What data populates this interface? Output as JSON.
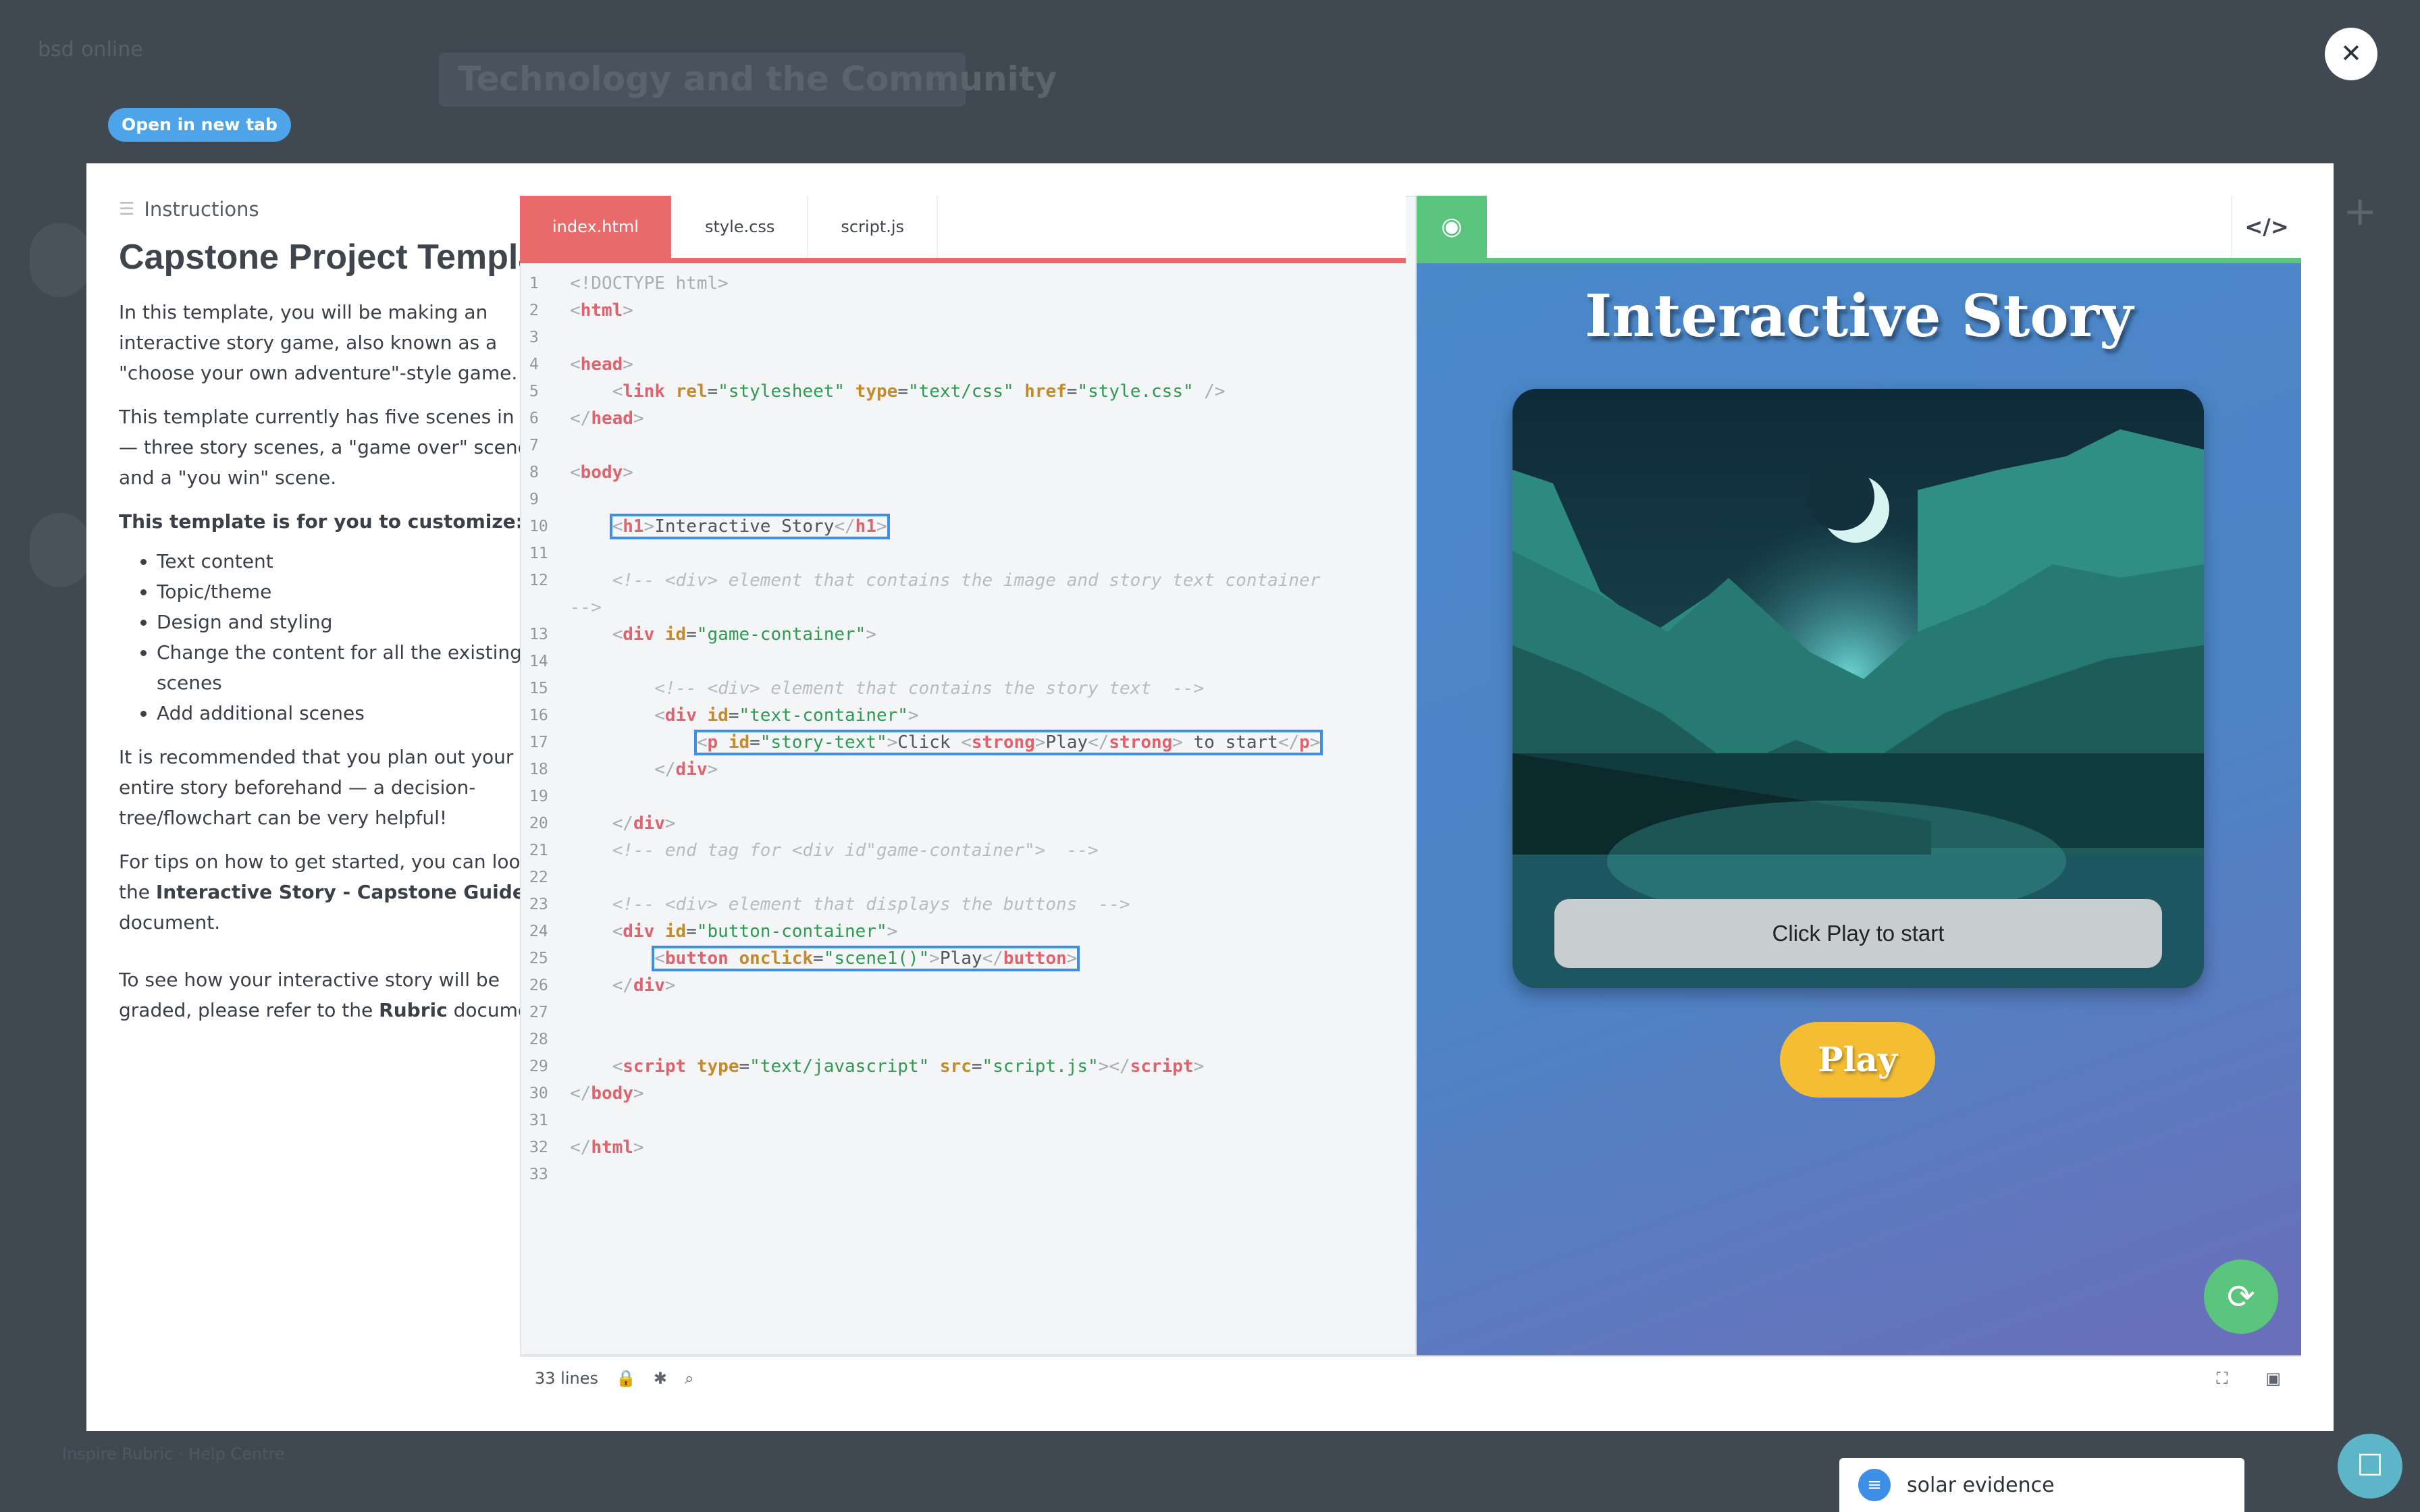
{
  "background": {
    "logo": "bsd",
    "logo_suffix": "online",
    "page_title": "Technology and the Community",
    "footer": "Inspire Rubric · Help Centre"
  },
  "modal": {
    "open_new_tab": "Open in new tab",
    "close_icon": "close-icon"
  },
  "instructions": {
    "header": "Instructions",
    "title": "Capstone Project Template",
    "p1": "In this template, you will be making an interactive story game, also known as a \"choose your own adventure\"-style game.",
    "p2": "This template currently has five scenes in total — three story scenes, a \"game over\" scene, and a \"you win\" scene.",
    "p3_bold": "This template is for you to customize:",
    "bullets": [
      "Text content",
      "Topic/theme",
      "Design and styling",
      "Change the content for all the existing scenes",
      "Add additional scenes"
    ],
    "p4": "It is recommended that you plan out your entire story beforehand — a decision-tree/flowchart can be very helpful!",
    "p5_pre": "For tips on how to get started, you can look at the ",
    "p5_bold": "Interactive Story - Capstone Guide",
    "p5_post": " document.",
    "p6_pre": "To see how your interactive story will be graded, please refer to the ",
    "p6_bold": "Rubric",
    "p6_post": " document."
  },
  "editor": {
    "tabs": [
      "index.html",
      "style.css",
      "script.js"
    ],
    "active_tab": "index.html",
    "line_count_label": "33 lines",
    "line_numbers": [
      "1",
      "2",
      "3",
      "4",
      "5",
      "6",
      "7",
      "8",
      "9",
      "10",
      "11",
      "12",
      "13",
      "14",
      "15",
      "16",
      "17",
      "18",
      "19",
      "20",
      "21",
      "22",
      "23",
      "24",
      "25",
      "26",
      "27",
      "28",
      "29",
      "30",
      "31",
      "32",
      "33"
    ]
  },
  "preview": {
    "heading": "Interactive Story",
    "story_text": "Click Play to start",
    "play_button": "Play"
  },
  "chat": {
    "label": "solar evidence"
  },
  "colors": {
    "accent_red": "#e96a6a",
    "accent_green": "#5cc57d",
    "accent_blue": "#3d8ee6",
    "play_yellow": "#f4bd34"
  }
}
